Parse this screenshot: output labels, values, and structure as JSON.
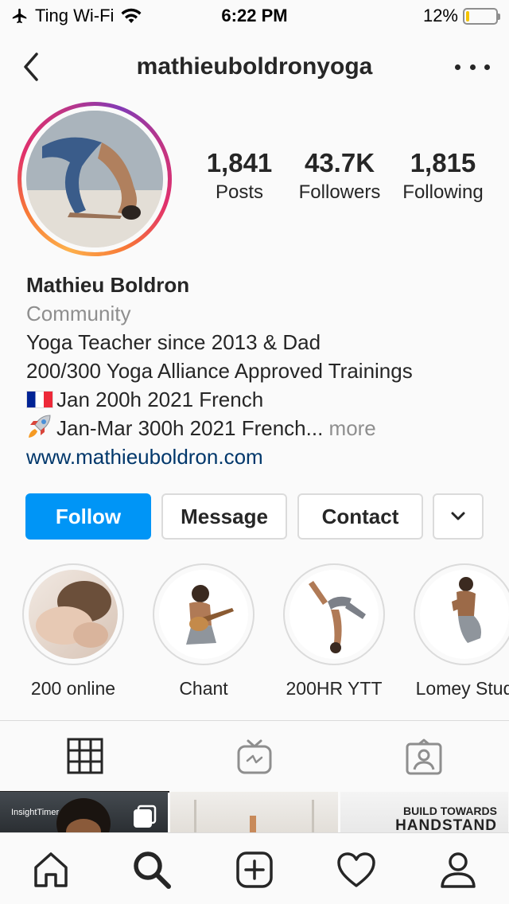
{
  "status_bar": {
    "carrier": "Ting Wi-Fi",
    "time": "6:22 PM",
    "battery_percent": "12%",
    "battery_level": 0.12
  },
  "header": {
    "username": "mathieuboldronyoga"
  },
  "stats": {
    "posts_count": "1,841",
    "posts_label": "Posts",
    "followers_count": "43.7K",
    "followers_label": "Followers",
    "following_count": "1,815",
    "following_label": "Following"
  },
  "bio": {
    "name": "Mathieu Boldron",
    "category": "Community",
    "line1": "Yoga Teacher since 2013 & Dad",
    "line2": "200/300 Yoga Alliance Approved Trainings",
    "line3": "Jan 200h 2021 French",
    "line4": "Jan-Mar 300h 2021 French...",
    "more_label": "more",
    "website": "www.mathieuboldron.com"
  },
  "buttons": {
    "follow": "Follow",
    "message": "Message",
    "contact": "Contact"
  },
  "highlights": [
    {
      "label": "200 online"
    },
    {
      "label": "Chant"
    },
    {
      "label": "200HR YTT"
    },
    {
      "label": "Lomey Stud"
    }
  ],
  "grid": {
    "cell1_tag": "InsightTimer",
    "cell3_line1": "BUILD TOWARDS",
    "cell3_line2": "HANDSTAND"
  },
  "colors": {
    "follow_button": "#0095f6",
    "link": "#00376b",
    "muted_text": "#8e8e8e",
    "battery_low": "#f5c400"
  },
  "icons": {
    "tabs": [
      "grid-icon",
      "igtv-icon",
      "tagged-icon"
    ],
    "nav": [
      "home-icon",
      "search-icon",
      "new-post-icon",
      "activity-heart-icon",
      "profile-icon"
    ]
  }
}
